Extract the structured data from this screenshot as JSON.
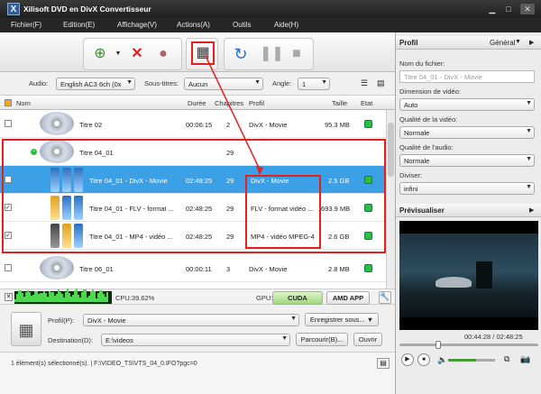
{
  "window": {
    "title": "Xilisoft DVD en DivX Convertisseur"
  },
  "menu": [
    "Fichier(F)",
    "Edition(E)",
    "Affichage(V)",
    "Actions(A)",
    "Outils",
    "Aide(H)"
  ],
  "options": {
    "audio_label": "Audio:",
    "audio_value": "English AC3 6ch (0x",
    "subs_label": "Sous-titres:",
    "subs_value": "Aucun",
    "angle_label": "Angle:",
    "angle_value": "1"
  },
  "columns": {
    "name": "Nom",
    "duration": "Durée",
    "chapters": "Chapitres",
    "profile": "Profil",
    "size": "Taille",
    "state": "Etat"
  },
  "rows": [
    {
      "name": "Titre 02",
      "duration": "00:06:15",
      "chapters": "2",
      "profile": "DivX - Movie",
      "size": "95.3 MB"
    },
    {
      "name": "Titre 04_01",
      "duration": "",
      "chapters": "29",
      "profile": "",
      "size": ""
    },
    {
      "name": "Titre 04_01 - DivX - Movie",
      "duration": "02:48:25",
      "chapters": "29",
      "profile": "DivX - Movie",
      "size": "2.5 GB"
    },
    {
      "name": "Titre 04_01 - FLV - format ...",
      "duration": "02:48:25",
      "chapters": "29",
      "profile": "FLV - format vidéo ...",
      "size": "693.9 MB"
    },
    {
      "name": "Titre 04_01 - MP4 - vidéo ...",
      "duration": "02:48:25",
      "chapters": "29",
      "profile": "MP4 - vidéo MPEG-4",
      "size": "2.6 GB"
    },
    {
      "name": "Titre 06_01",
      "duration": "00:00:11",
      "chapters": "3",
      "profile": "DivX - Movie",
      "size": "2.8 MB"
    }
  ],
  "cpu": {
    "label": "CPU:39.62%",
    "gpu_label": "GPU:",
    "cuda": "CUDA",
    "amd": "AMD APP"
  },
  "output": {
    "profile_label": "Profil(P):",
    "profile_value": "DivX - Movie",
    "save_as": "Enregistrer sous...",
    "dest_label": "Destination(D):",
    "dest_value": "E:\\videos",
    "browse": "Parcourir(B)...",
    "open": "Ouvrir"
  },
  "status": {
    "text": "1 élément(s) sélectionné(s). | F:\\VIDEO_TS\\VTS_04_0.IFO?pgc=0"
  },
  "right": {
    "profil_head": "Profil",
    "general": "Général",
    "filename_label": "Nom du fichier:",
    "filename_value": "Titre 04_01 - DivX - Movie",
    "dim_label": "Dimension de vidéo:",
    "dim_value": "Auto",
    "vq_label": "Qualité de la vidéo:",
    "vq_value": "Normale",
    "aq_label": "Qualité de l'audio:",
    "aq_value": "Normale",
    "split_label": "Diviser:",
    "split_value": "infini",
    "preview_head": "Prévisualiser",
    "time": "00:44:28 / 02:48:25"
  },
  "colors": {
    "selection": "#3ba0e6",
    "highlight": "#e32020",
    "status_ok": "#2fbf3a"
  }
}
